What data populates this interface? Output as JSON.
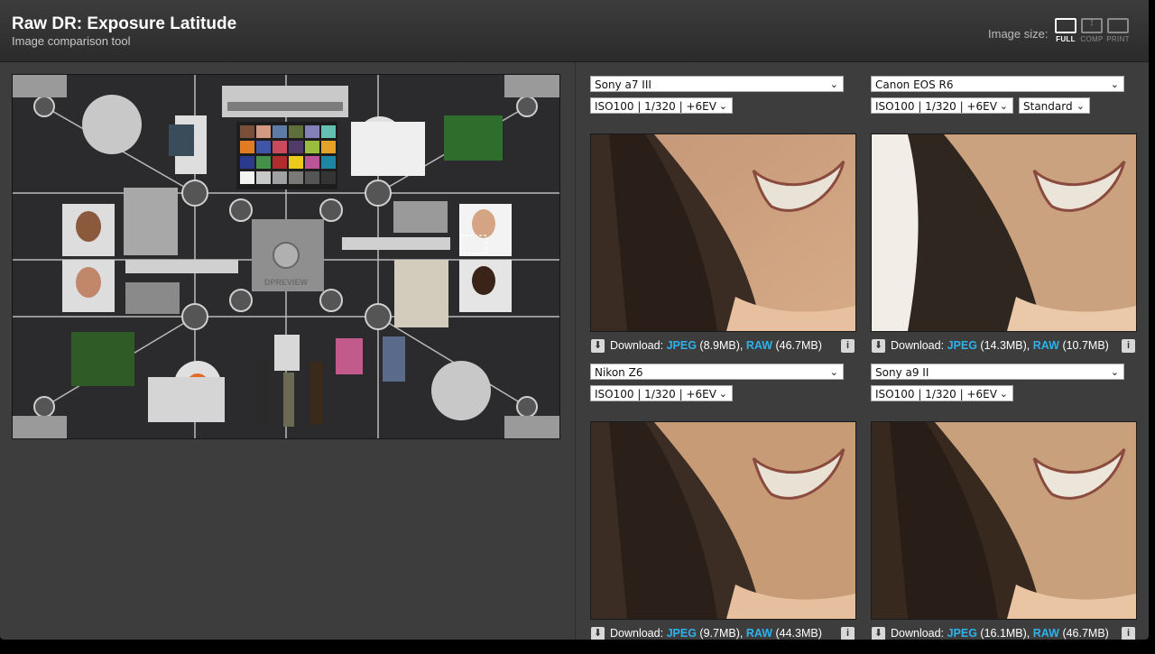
{
  "header": {
    "title": "Raw DR: Exposure Latitude",
    "subtitle": "Image comparison tool",
    "image_size_label": "Image size:",
    "size_options": [
      {
        "label": "FULL",
        "active": true
      },
      {
        "label": "COMP",
        "active": false
      },
      {
        "label": "PRINT",
        "active": false
      }
    ]
  },
  "scene": {
    "label": "DPREVIEW"
  },
  "download_prefix": "Download:",
  "panels": [
    {
      "camera": "Sony a7 III",
      "setting": "ISO100 | 1/320 | +6EV",
      "jpeg_label": "JPEG",
      "jpeg_size": "(8.9MB),",
      "raw_label": "RAW",
      "raw_size": "(46.7MB)"
    },
    {
      "camera": "Canon EOS R6",
      "setting": "ISO100 | 1/320 | +6EV",
      "extra_setting": "Standard",
      "jpeg_label": "JPEG",
      "jpeg_size": "(14.3MB),",
      "raw_label": "RAW",
      "raw_size": "(10.7MB)"
    },
    {
      "camera": "Nikon Z6",
      "setting": "ISO100 | 1/320 | +6EV",
      "jpeg_label": "JPEG",
      "jpeg_size": "(9.7MB),",
      "raw_label": "RAW",
      "raw_size": "(44.3MB)"
    },
    {
      "camera": "Sony a9 II",
      "setting": "ISO100 | 1/320 | +6EV",
      "jpeg_label": "JPEG",
      "jpeg_size": "(16.1MB),",
      "raw_label": "RAW",
      "raw_size": "(46.7MB)"
    }
  ],
  "colors": {
    "link": "#2fb1ea",
    "background": "#3d3d3d",
    "header": "#2b2b2b"
  }
}
